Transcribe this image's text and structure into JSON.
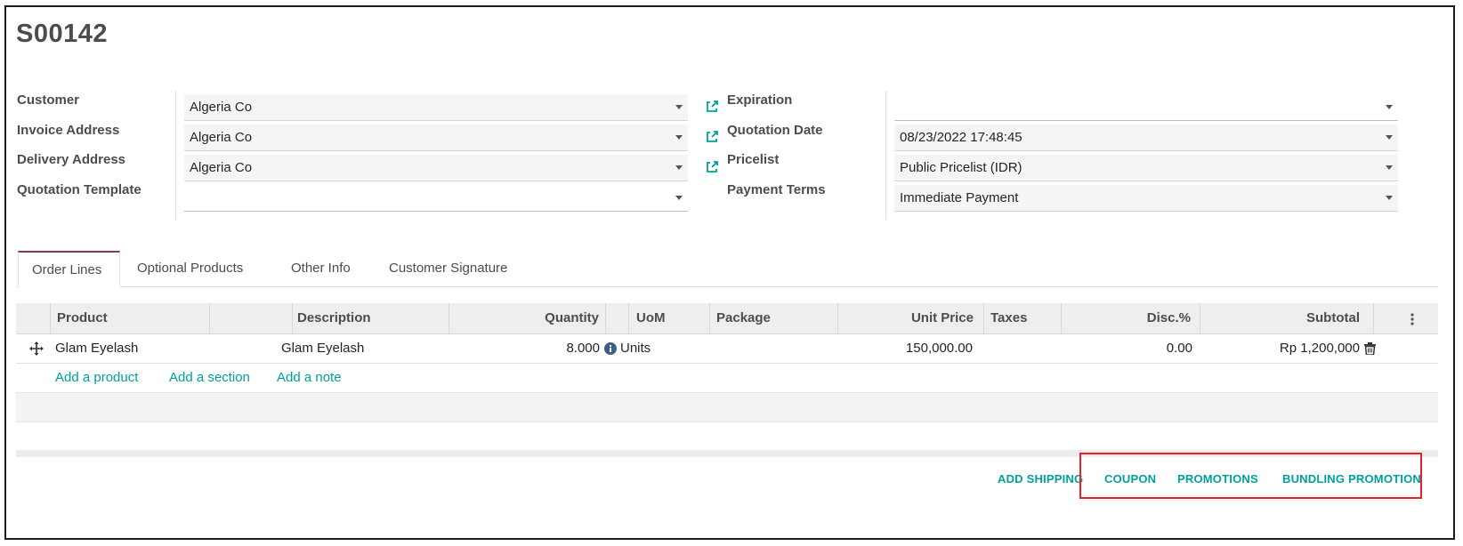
{
  "record": {
    "title": "S00142"
  },
  "left_fields": [
    {
      "label": "Customer",
      "value": "Algeria Co",
      "has_link": true
    },
    {
      "label": "Invoice Address",
      "value": "Algeria Co",
      "has_link": true
    },
    {
      "label": "Delivery Address",
      "value": "Algeria Co",
      "has_link": true
    },
    {
      "label": "Quotation Template",
      "value": "",
      "has_link": false
    }
  ],
  "right_fields": [
    {
      "label": "Expiration",
      "value": ""
    },
    {
      "label": "Quotation Date",
      "value": "08/23/2022 17:48:45"
    },
    {
      "label": "Pricelist",
      "value": "Public Pricelist (IDR)"
    },
    {
      "label": "Payment Terms",
      "value": "Immediate Payment"
    }
  ],
  "tabs": [
    "Order Lines",
    "Optional Products",
    "Other Info",
    "Customer Signature"
  ],
  "active_tab": "Order Lines",
  "table": {
    "columns": [
      "Product",
      "Description",
      "Quantity",
      "UoM",
      "Package",
      "Unit Price",
      "Taxes",
      "Disc.%",
      "Subtotal"
    ],
    "rows": [
      {
        "product": "Glam Eyelash",
        "description": "Glam Eyelash",
        "quantity": "8.000",
        "uom": "Units",
        "package": "",
        "unit_price": "150,000.00",
        "taxes": "",
        "discount": "0.00",
        "subtotal": "Rp 1,200,000"
      }
    ],
    "add_links": [
      "Add a product",
      "Add a section",
      "Add a note"
    ]
  },
  "actions": [
    "ADD SHIPPING",
    "COUPON",
    "PROMOTIONS",
    "BUNDLING PROMOTION"
  ],
  "colors": {
    "accent": "#00a09d",
    "tab_active_border": "#7c3d5b",
    "highlight": "#e8202a"
  },
  "icons": [
    "external-link-icon",
    "info-icon",
    "drag-handle-icon",
    "trash-icon",
    "optional-columns-icon",
    "dropdown-caret-icon"
  ]
}
